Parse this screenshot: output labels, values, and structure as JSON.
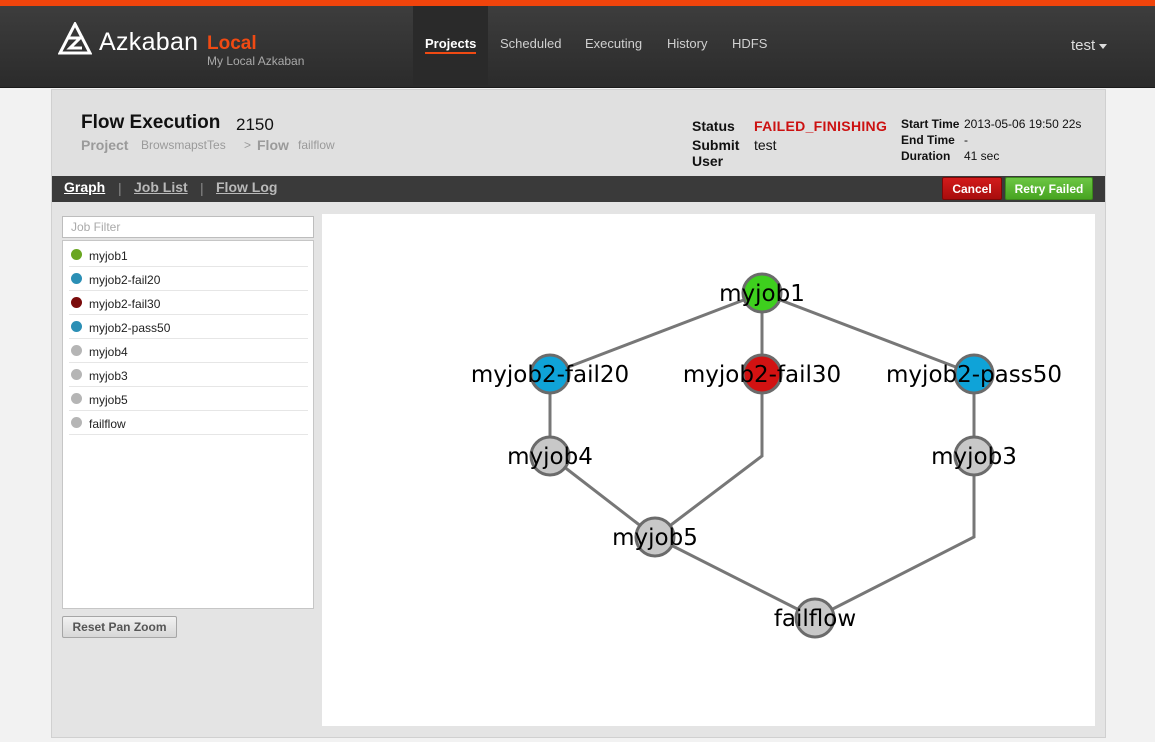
{
  "app": {
    "brand": "Azkaban",
    "brand_local": "Local",
    "brand_sub": "My Local Azkaban",
    "accent_color": "#f04a13"
  },
  "nav": {
    "items": [
      {
        "label": "Projects",
        "active": true
      },
      {
        "label": "Scheduled",
        "active": false
      },
      {
        "label": "Executing",
        "active": false
      },
      {
        "label": "History",
        "active": false
      },
      {
        "label": "HDFS",
        "active": false
      }
    ],
    "user": "test"
  },
  "execution": {
    "title": "Flow Execution",
    "id": "2150",
    "project_label": "Project",
    "project": "BrowsmapstTes",
    "flow_separator": ">",
    "flow_label": "Flow",
    "flow": "failflow",
    "status_label": "Status",
    "status": "FAILED_FINISHING",
    "submit_user_label_1": "Submit",
    "submit_user_label_2": "User",
    "submit_user": "test",
    "start_time_label": "Start Time",
    "start_time": "2013-05-06 19:50 22s",
    "end_time_label": "End Time",
    "end_time": "-",
    "duration_label": "Duration",
    "duration": "41 sec"
  },
  "tabs": [
    {
      "label": "Graph",
      "active": true
    },
    {
      "label": "Job List",
      "active": false
    },
    {
      "label": "Flow Log",
      "active": false
    }
  ],
  "tab_separator": "|",
  "actions": {
    "cancel": "Cancel",
    "retry": "Retry Failed",
    "cancel_color": "#c01212",
    "retry_color": "#5cb531"
  },
  "side": {
    "filter_placeholder": "Job Filter",
    "reset_label": "Reset Pan Zoom"
  },
  "status_colors": {
    "succeeded": "#3ecf1e",
    "running": "#0fa3d8",
    "failed": "#d21212",
    "ready": "#c8c8c8"
  },
  "jobs": [
    {
      "name": "myjob1",
      "status": "succeeded",
      "list_color": "#69a620"
    },
    {
      "name": "myjob2-fail20",
      "status": "running",
      "list_color": "#2b8fb5"
    },
    {
      "name": "myjob2-fail30",
      "status": "failed",
      "list_color": "#7a0b0b"
    },
    {
      "name": "myjob2-pass50",
      "status": "running",
      "list_color": "#2b8fb5"
    },
    {
      "name": "myjob4",
      "status": "ready",
      "list_color": "#b5b5b5"
    },
    {
      "name": "myjob3",
      "status": "ready",
      "list_color": "#b5b5b5"
    },
    {
      "name": "myjob5",
      "status": "ready",
      "list_color": "#b5b5b5"
    },
    {
      "name": "failflow",
      "status": "ready",
      "list_color": "#b5b5b5"
    }
  ],
  "edges": [
    [
      "myjob1",
      "myjob2-fail20"
    ],
    [
      "myjob1",
      "myjob2-fail30"
    ],
    [
      "myjob1",
      "myjob2-pass50"
    ],
    [
      "myjob2-fail20",
      "myjob4"
    ],
    [
      "myjob2-pass50",
      "myjob3"
    ],
    [
      "myjob4",
      "myjob5"
    ],
    [
      "myjob2-fail30",
      "myjob5"
    ],
    [
      "myjob5",
      "failflow"
    ],
    [
      "myjob3",
      "failflow"
    ]
  ]
}
